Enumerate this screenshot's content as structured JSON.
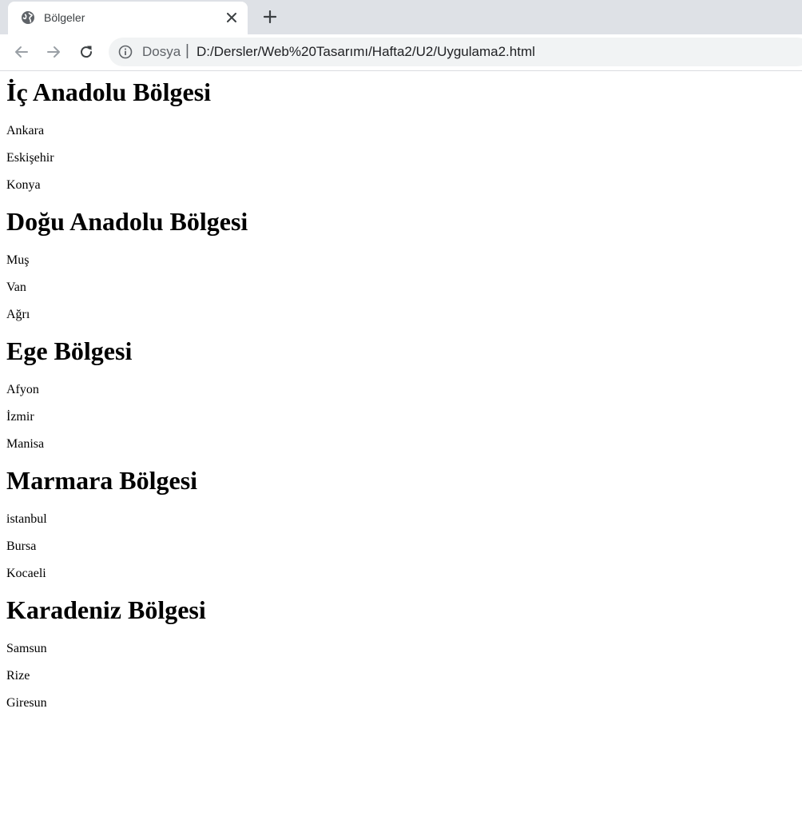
{
  "browser": {
    "tab_title": "Bölgeler",
    "scheme_label": "Dosya",
    "separator": "|",
    "url": "D:/Dersler/Web%20Tasarımı/Hafta2/U2/Uygulama2.html"
  },
  "regions": [
    {
      "heading": "İç Anadolu Bölgesi",
      "cities": [
        "Ankara",
        "Eskişehir",
        "Konya"
      ]
    },
    {
      "heading": "Doğu Anadolu Bölgesi",
      "cities": [
        "Muş",
        "Van",
        "Ağrı"
      ]
    },
    {
      "heading": "Ege Bölgesi",
      "cities": [
        "Afyon",
        "İzmir",
        "Manisa"
      ]
    },
    {
      "heading": "Marmara Bölgesi",
      "cities": [
        "istanbul",
        "Bursa",
        "Kocaeli"
      ]
    },
    {
      "heading": "Karadeniz Bölgesi",
      "cities": [
        "Samsun",
        "Rize",
        "Giresun"
      ]
    }
  ]
}
